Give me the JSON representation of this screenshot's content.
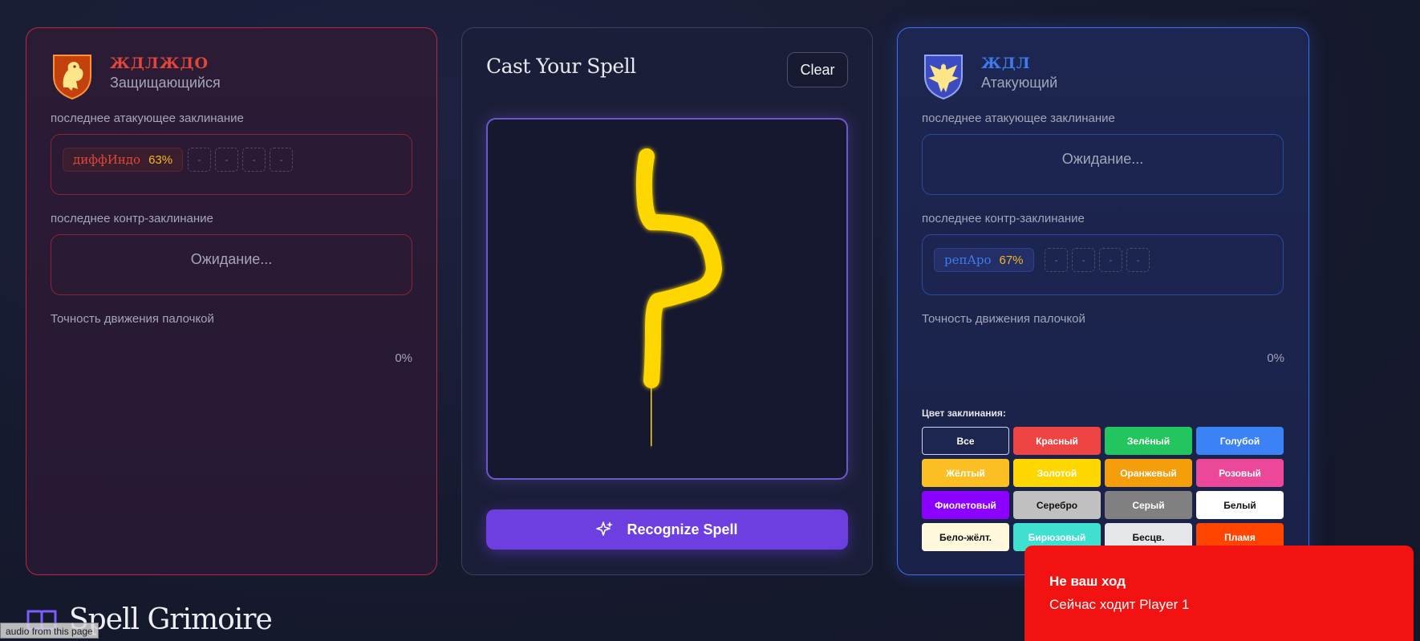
{
  "left_player": {
    "name": "ЖДЛЖДО",
    "role": "Защищающийся",
    "attack_label": "последнее атакующее заклинание",
    "attack_spell": {
      "name": "диффИндо",
      "confidence": "63%"
    },
    "counter_label": "последнее контр-заклинание",
    "counter_status": "Ожидание...",
    "accuracy_label": "Точность движения палочкой",
    "accuracy_value": "0%",
    "slot_placeholder": "-"
  },
  "center": {
    "title": "Cast Your Spell",
    "clear_label": "Clear",
    "recognize_label": "Recognize Spell"
  },
  "right_player": {
    "name": "ЖДЛ",
    "role": "Атакующий",
    "attack_label": "последнее атакующее заклинание",
    "attack_status": "Ожидание...",
    "counter_label": "последнее контр-заклинание",
    "counter_spell": {
      "name": "репАро",
      "confidence": "67%"
    },
    "accuracy_label": "Точность движения палочкой",
    "accuracy_value": "0%",
    "slot_placeholder": "-"
  },
  "spell_colors": {
    "title": "Цвет заклинания:",
    "options": [
      {
        "label": "Все",
        "bg": "#1d2650",
        "fg": "#ffffff",
        "selected": true
      },
      {
        "label": "Красный",
        "bg": "#ef4444",
        "fg": "#ffffff"
      },
      {
        "label": "Зелёный",
        "bg": "#22c55e",
        "fg": "#ffffff"
      },
      {
        "label": "Голубой",
        "bg": "#3b82f6",
        "fg": "#ffffff"
      },
      {
        "label": "Жёлтый",
        "bg": "#fbbf24",
        "fg": "#ffffff"
      },
      {
        "label": "Золотой",
        "bg": "#ffd700",
        "fg": "#ffffff"
      },
      {
        "label": "Оранжевый",
        "bg": "#f59e0b",
        "fg": "#ffffff"
      },
      {
        "label": "Розовый",
        "bg": "#ec4899",
        "fg": "#ffffff"
      },
      {
        "label": "Фиолетовый",
        "bg": "#8b00ff",
        "fg": "#ffffff"
      },
      {
        "label": "Серебро",
        "bg": "#c0c0c0",
        "fg": "#111111"
      },
      {
        "label": "Серый",
        "bg": "#808080",
        "fg": "#ffffff"
      },
      {
        "label": "Белый",
        "bg": "#ffffff",
        "fg": "#111111"
      },
      {
        "label": "Бело-жёлт.",
        "bg": "#fff8dc",
        "fg": "#111111"
      },
      {
        "label": "Бирюзовый",
        "bg": "#40e0d0",
        "fg": "#ffffff"
      },
      {
        "label": "Бесцв.",
        "bg": "#e5e7eb",
        "fg": "#111111"
      },
      {
        "label": "Пламя",
        "bg": "#ff4500",
        "fg": "#ffffff"
      }
    ]
  },
  "toast": {
    "title": "Не ваш ход",
    "message": "Сейчас ходит Player 1"
  },
  "brand": {
    "name": "Spell Grimoire"
  },
  "audio_tooltip": "audio from this page",
  "colors": {
    "stroke": "#ffd700",
    "left_accent": "#e2453a",
    "right_accent": "#3e7bf0",
    "primary_button": "#6d3ee0",
    "toast_bg": "#f21212"
  }
}
